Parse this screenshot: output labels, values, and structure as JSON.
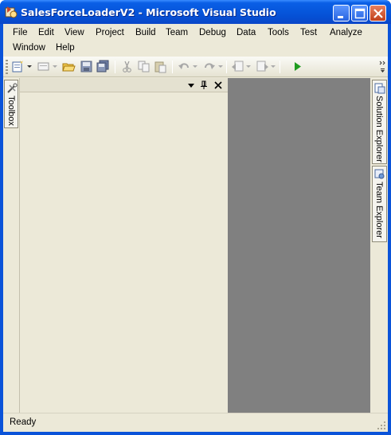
{
  "window": {
    "title": "SalesForceLoaderV2 - Microsoft Visual Studio",
    "controls": {
      "minimize": "minimize",
      "maximize": "maximize",
      "close": "close"
    }
  },
  "menubar": {
    "items": [
      "File",
      "Edit",
      "View",
      "Project",
      "Build",
      "Team",
      "Debug",
      "Data",
      "Tools",
      "Test",
      "Analyze",
      "Window",
      "Help"
    ]
  },
  "toolbar": {
    "icons": [
      "new-project-icon",
      "add-item-icon",
      "open-file-icon",
      "save-icon",
      "save-all-icon",
      "cut-icon",
      "copy-icon",
      "paste-icon",
      "undo-icon",
      "redo-icon",
      "navigate-backward-icon",
      "navigate-forward-icon",
      "start-debugging-icon"
    ]
  },
  "left_dock": {
    "tabs": [
      {
        "label": "Toolbox",
        "icon": "toolbox-icon"
      }
    ]
  },
  "right_dock": {
    "tabs": [
      {
        "label": "Solution Explorer",
        "icon": "solution-explorer-icon"
      },
      {
        "label": "Team Explorer",
        "icon": "team-explorer-icon"
      }
    ]
  },
  "panel": {
    "buttons": [
      "window-position-icon",
      "auto-hide-pin-icon",
      "close-panel-icon"
    ]
  },
  "statusbar": {
    "text": "Ready"
  },
  "colors": {
    "titlebar": "#0550d4",
    "chrome": "#ece9d8",
    "document_area": "#808080",
    "run_green": "#1f9c1f"
  }
}
